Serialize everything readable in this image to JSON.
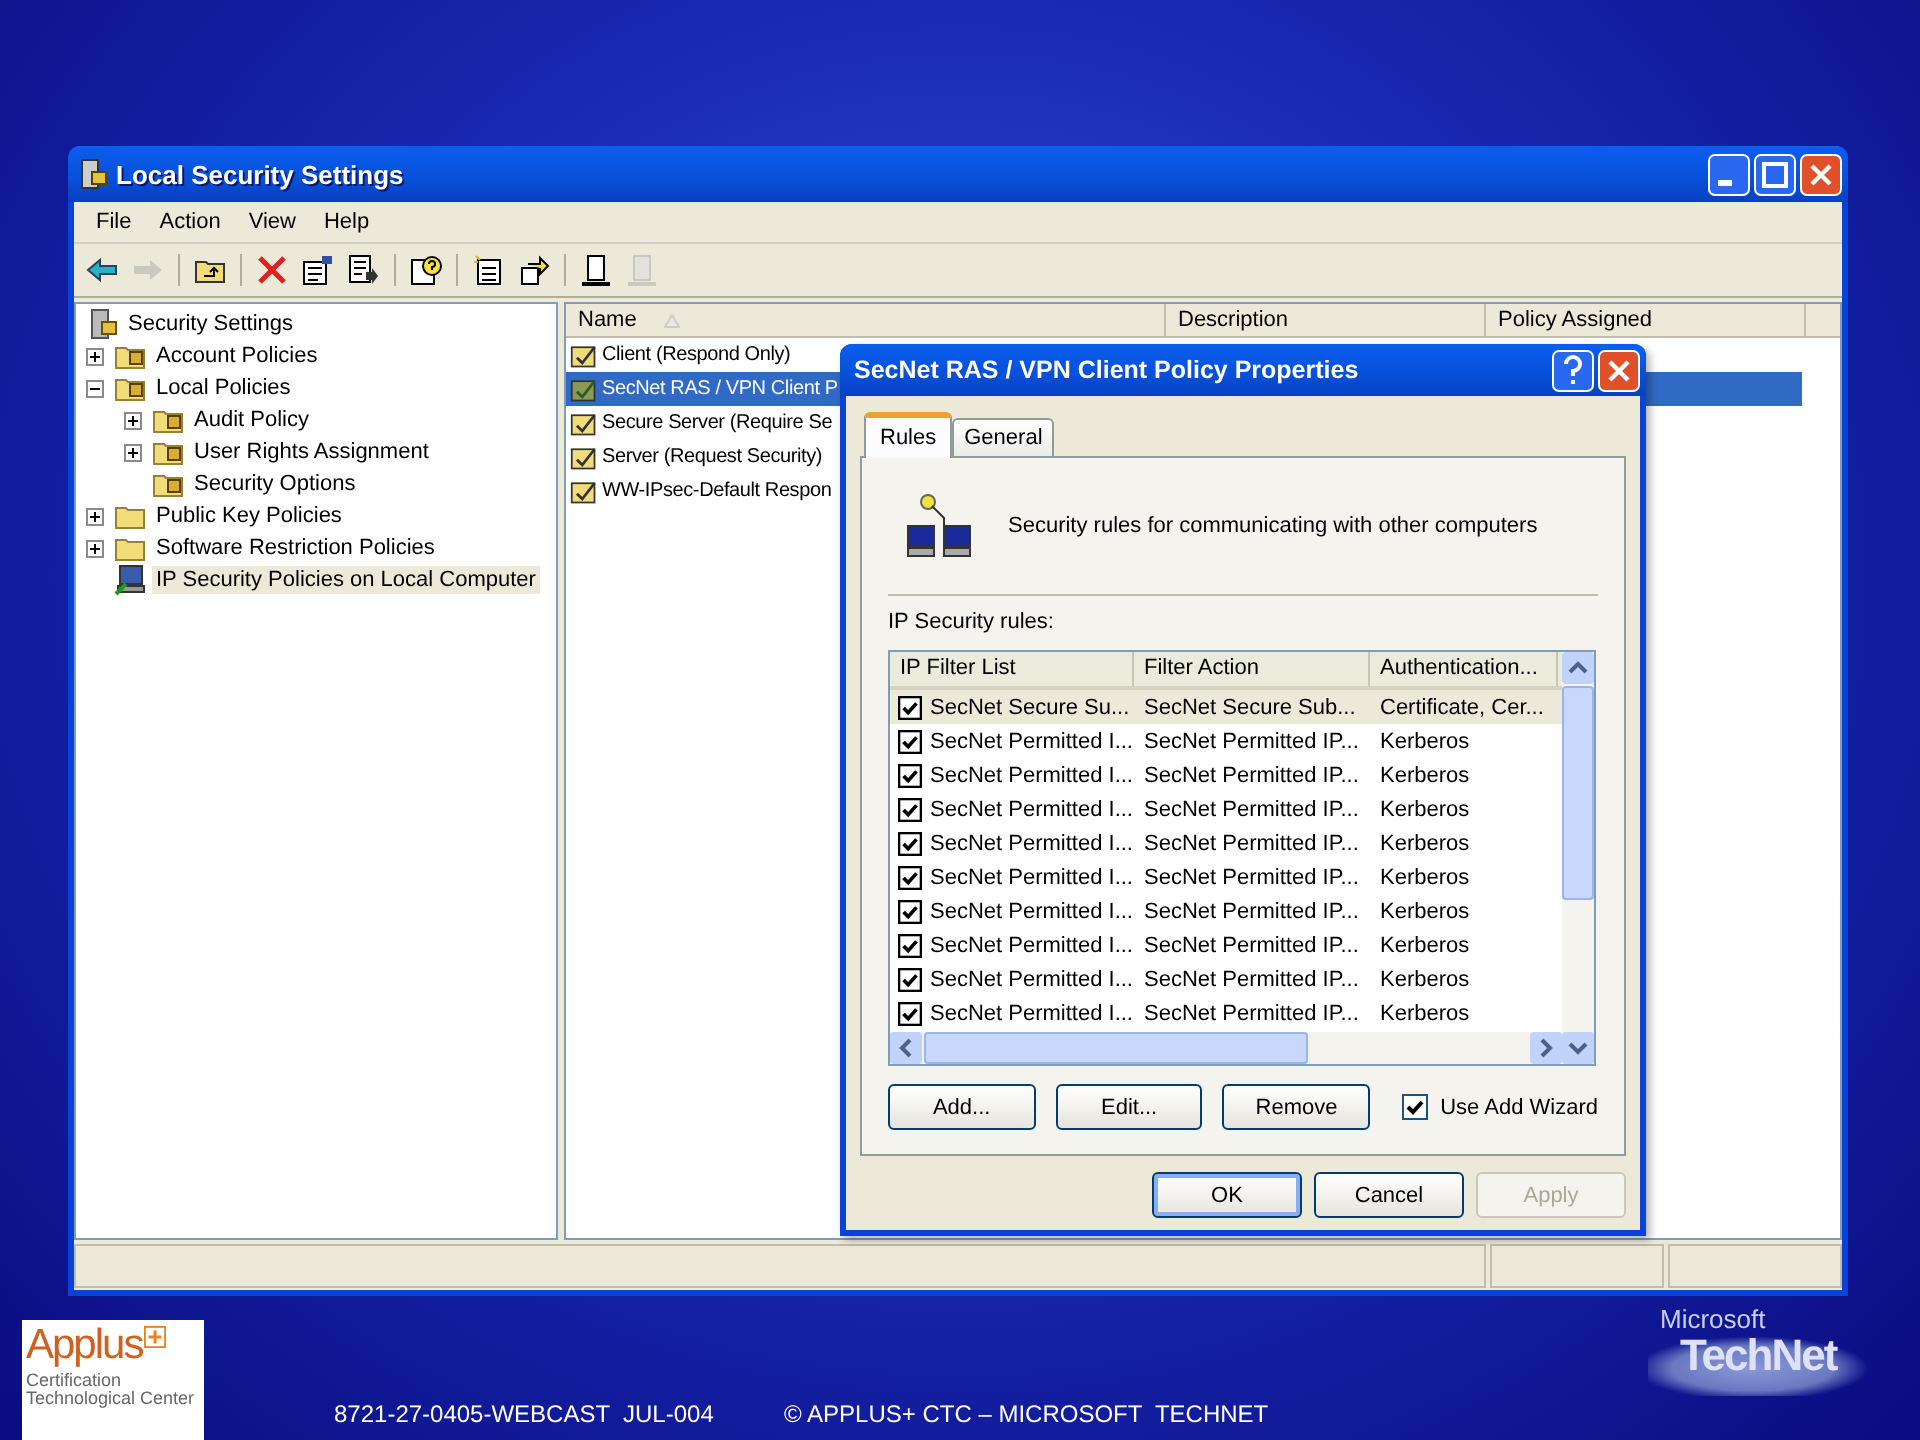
{
  "window": {
    "title": "Local Security Settings"
  },
  "menu": [
    "File",
    "Action",
    "View",
    "Help"
  ],
  "toolbar": [
    {
      "kind": "back",
      "disabled": false,
      "separator_before": false
    },
    {
      "kind": "forward",
      "disabled": true,
      "separator_before": false
    },
    {
      "kind": "up",
      "disabled": false,
      "separator_before": true
    },
    {
      "kind": "delete",
      "disabled": false,
      "separator_before": true
    },
    {
      "kind": "properties",
      "disabled": false,
      "separator_before": false
    },
    {
      "kind": "export",
      "disabled": false,
      "separator_before": false
    },
    {
      "kind": "help",
      "disabled": false,
      "separator_before": true
    },
    {
      "kind": "new",
      "disabled": false,
      "separator_before": true
    },
    {
      "kind": "assign",
      "disabled": false,
      "separator_before": false
    },
    {
      "kind": "tool",
      "disabled": false,
      "separator_before": true
    },
    {
      "kind": "tool",
      "disabled": true,
      "separator_before": false
    }
  ],
  "tree": {
    "label": "Security Settings",
    "kind": "root",
    "selected": false,
    "children": [
      {
        "label": "Account Policies",
        "kind": "lock-folder",
        "expanded": false,
        "selected": false
      },
      {
        "label": "Local Policies",
        "kind": "lock-folder",
        "expanded": true,
        "selected": false,
        "children": [
          {
            "label": "Audit Policy",
            "kind": "lock-folder",
            "expanded": false,
            "selected": false
          },
          {
            "label": "User Rights Assignment",
            "kind": "lock-folder",
            "expanded": false,
            "selected": false
          },
          {
            "label": "Security Options",
            "kind": "lock-folder",
            "selected": false
          }
        ]
      },
      {
        "label": "Public Key Policies",
        "kind": "folder",
        "expanded": false,
        "selected": false
      },
      {
        "label": "Software Restriction Policies",
        "kind": "folder",
        "expanded": false,
        "selected": false
      },
      {
        "label": "IP Security Policies on Local Computer",
        "kind": "computer",
        "selected": true
      }
    ]
  },
  "list": {
    "columns": [
      "Name",
      "Description",
      "Policy Assigned"
    ],
    "items": [
      {
        "label": "Client (Respond Only)",
        "selected": false
      },
      {
        "label": "SecNet RAS / VPN Client P",
        "selected": true
      },
      {
        "label": "Secure Server (Require Se",
        "selected": false
      },
      {
        "label": "Server (Request Security)",
        "selected": false
      },
      {
        "label": "WW-IPsec-Default Respon",
        "selected": false
      }
    ]
  },
  "dialog": {
    "title": "SecNet RAS / VPN Client Policy Properties",
    "tabs": [
      {
        "label": "Rules",
        "selected": true
      },
      {
        "label": "General",
        "selected": false
      }
    ],
    "description": "Security rules for communicating with other computers",
    "rules_label": "IP Security rules:",
    "columns": [
      "IP Filter List",
      "Filter Action",
      "Authentication..."
    ],
    "rules": [
      {
        "checked": true,
        "selected": true,
        "ip_filter_list": "SecNet Secure Su...",
        "filter_action": "SecNet Secure Sub...",
        "authentication": "Certificate, Cer..."
      },
      {
        "checked": true,
        "selected": false,
        "ip_filter_list": "SecNet Permitted I...",
        "filter_action": "SecNet Permitted IP...",
        "authentication": "Kerberos"
      },
      {
        "checked": true,
        "selected": false,
        "ip_filter_list": "SecNet Permitted I...",
        "filter_action": "SecNet Permitted IP...",
        "authentication": "Kerberos"
      },
      {
        "checked": true,
        "selected": false,
        "ip_filter_list": "SecNet Permitted I...",
        "filter_action": "SecNet Permitted IP...",
        "authentication": "Kerberos"
      },
      {
        "checked": true,
        "selected": false,
        "ip_filter_list": "SecNet Permitted I...",
        "filter_action": "SecNet Permitted IP...",
        "authentication": "Kerberos"
      },
      {
        "checked": true,
        "selected": false,
        "ip_filter_list": "SecNet Permitted I...",
        "filter_action": "SecNet Permitted IP...",
        "authentication": "Kerberos"
      },
      {
        "checked": true,
        "selected": false,
        "ip_filter_list": "SecNet Permitted I...",
        "filter_action": "SecNet Permitted IP...",
        "authentication": "Kerberos"
      },
      {
        "checked": true,
        "selected": false,
        "ip_filter_list": "SecNet Permitted I...",
        "filter_action": "SecNet Permitted IP...",
        "authentication": "Kerberos"
      },
      {
        "checked": true,
        "selected": false,
        "ip_filter_list": "SecNet Permitted I...",
        "filter_action": "SecNet Permitted IP...",
        "authentication": "Kerberos"
      },
      {
        "checked": true,
        "selected": false,
        "ip_filter_list": "SecNet Permitted I...",
        "filter_action": "SecNet Permitted IP...",
        "authentication": "Kerberos"
      }
    ],
    "rule_buttons": [
      "Add...",
      "Edit...",
      "Remove"
    ],
    "use_add_wizard": {
      "label": "Use Add Wizard",
      "checked": true
    },
    "buttons": [
      {
        "label": "OK",
        "disabled": false,
        "default": true
      },
      {
        "label": "Cancel",
        "disabled": false,
        "default": false
      },
      {
        "label": "Apply",
        "disabled": true,
        "default": false
      }
    ]
  },
  "footer": {
    "logo": "Applus",
    "tagline": "Certification Technological Center",
    "code": "8721-27-0405-WEBCAST  JUL-004",
    "copyright": "© APPLUS+ CTC – MICROSOFT  TECHNET",
    "brand_top": "Microsoft",
    "brand_bottom": "TechNet"
  }
}
